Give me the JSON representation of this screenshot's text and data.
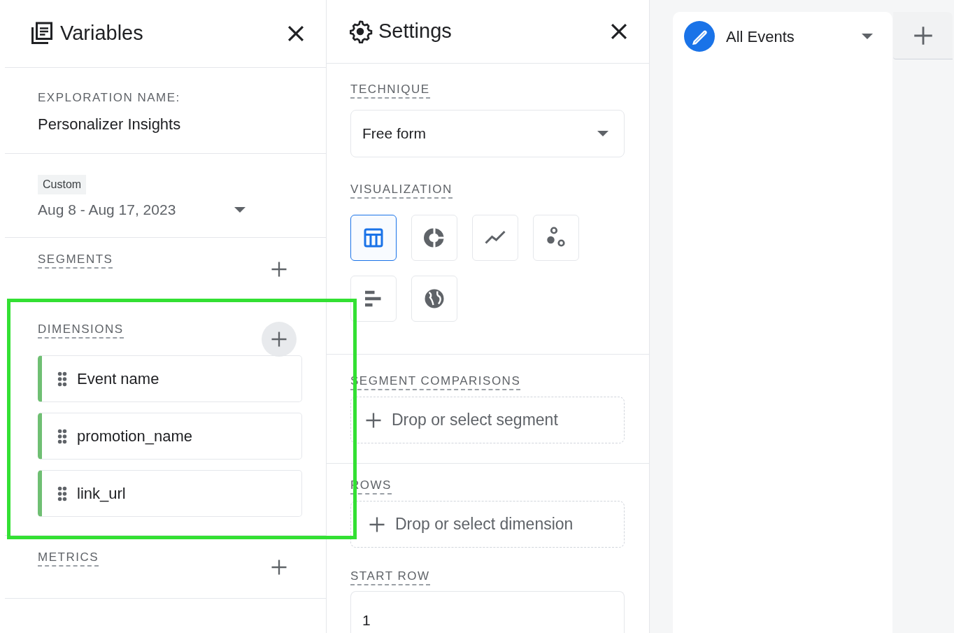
{
  "variables_panel": {
    "title": "Variables",
    "exploration_name": {
      "label": "EXPLORATION NAME:",
      "value": "Personalizer Insights"
    },
    "date_range": {
      "badge": "Custom",
      "value": "Aug 8 - Aug 17, 2023"
    },
    "sections": [
      {
        "label": "SEGMENTS",
        "add_hovered": false
      },
      {
        "label": "DIMENSIONS",
        "add_hovered": true,
        "items": [
          "Event name",
          "promotion_name",
          "link_url"
        ]
      },
      {
        "label": "METRICS",
        "add_hovered": false
      }
    ]
  },
  "settings_panel": {
    "title": "Settings",
    "technique": {
      "label": "TECHNIQUE",
      "value": "Free form"
    },
    "visualization": {
      "label": "VISUALIZATION",
      "options": [
        {
          "kind": "table",
          "selected": true
        },
        {
          "kind": "donut",
          "selected": false
        },
        {
          "kind": "line",
          "selected": false
        },
        {
          "kind": "scatter",
          "selected": false
        },
        {
          "kind": "bar",
          "selected": false
        },
        {
          "kind": "geo",
          "selected": false
        }
      ]
    },
    "segment_comparisons": {
      "label": "SEGMENT COMPARISONS",
      "placeholder": "Drop or select segment"
    },
    "rows": {
      "label": "ROWS",
      "placeholder": "Drop or select dimension"
    },
    "start_row": {
      "label": "START ROW",
      "value": "1"
    }
  },
  "tabs": [
    {
      "label": "All Events",
      "selected": true
    }
  ],
  "highlight_box": {
    "shown": true
  }
}
